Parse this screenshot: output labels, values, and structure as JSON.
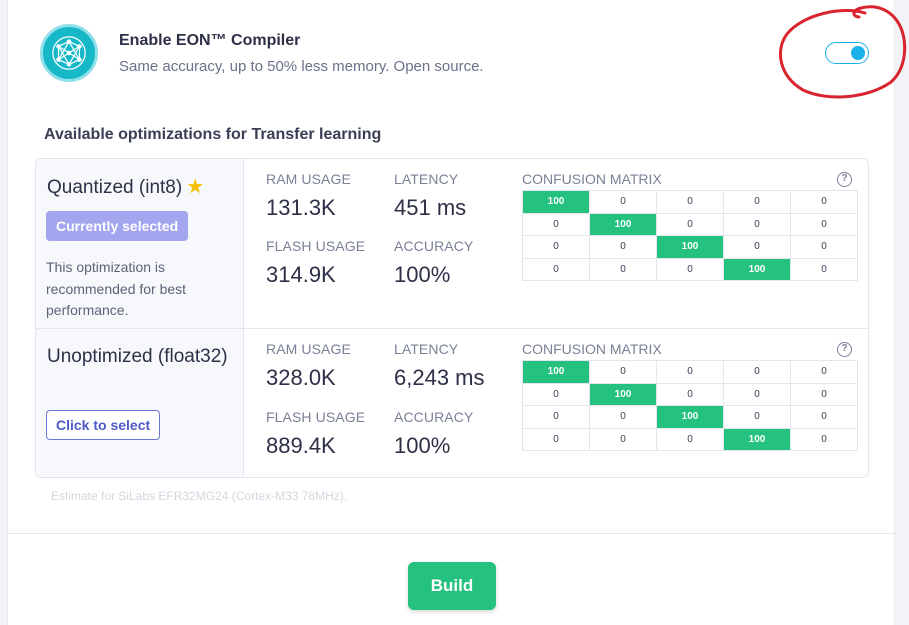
{
  "eon": {
    "title": "Enable EON™ Compiler",
    "subtitle": "Same accuracy, up to 50% less memory. Open source.",
    "enabled": true,
    "icon": "neural-network-icon"
  },
  "section_title": "Available optimizations for Transfer learning",
  "optimizations": [
    {
      "name": "Quantized (int8)",
      "starred": true,
      "button_label": "Currently selected",
      "description": "This optimization is recommended for best performance.",
      "ram_label": "RAM USAGE",
      "ram_value": "131.3K",
      "latency_label": "LATENCY",
      "latency_value": "451 ms",
      "flash_label": "FLASH USAGE",
      "flash_value": "314.9K",
      "accuracy_label": "ACCURACY",
      "accuracy_value": "100%",
      "cm_label": "CONFUSION MATRIX",
      "confusion_matrix": [
        [
          "100",
          "0",
          "0",
          "0",
          "0"
        ],
        [
          "0",
          "100",
          "0",
          "0",
          "0"
        ],
        [
          "0",
          "0",
          "100",
          "0",
          "0"
        ],
        [
          "0",
          "0",
          "0",
          "100",
          "0"
        ]
      ]
    },
    {
      "name": "Unoptimized (float32)",
      "starred": false,
      "button_label": "Click to select",
      "description": "",
      "ram_label": "RAM USAGE",
      "ram_value": "328.0K",
      "latency_label": "LATENCY",
      "latency_value": "6,243 ms",
      "flash_label": "FLASH USAGE",
      "flash_value": "889.4K",
      "accuracy_label": "ACCURACY",
      "accuracy_value": "100%",
      "cm_label": "CONFUSION MATRIX",
      "confusion_matrix": [
        [
          "100",
          "0",
          "0",
          "0",
          "0"
        ],
        [
          "0",
          "100",
          "0",
          "0",
          "0"
        ],
        [
          "0",
          "0",
          "100",
          "0",
          "0"
        ],
        [
          "0",
          "0",
          "0",
          "100",
          "0"
        ]
      ]
    }
  ],
  "help_glyph": "?",
  "star_glyph": "★",
  "estimate_note": "Estimate for SiLabs EFR32MG24 (Cortex-M33 78MHz).",
  "build_label": "Build",
  "colors": {
    "accent_green": "#25c17f",
    "toggle_blue": "#1ab1e8",
    "selected_purple": "#a3a5ee",
    "annotation_red": "#d9232e"
  }
}
